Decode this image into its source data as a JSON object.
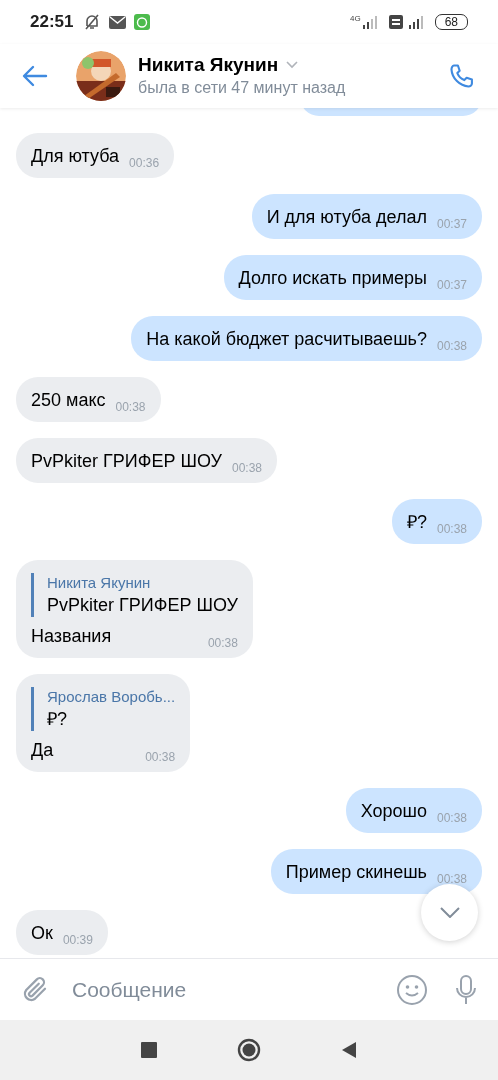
{
  "status_bar": {
    "time": "22:51",
    "network": "4G",
    "battery": "68"
  },
  "header": {
    "name": "Никита Якунин",
    "status": "была в сети 47 минут назад"
  },
  "messages": [
    {
      "kind": "incoming",
      "text": "Для ютуба",
      "time": "00:36"
    },
    {
      "kind": "outgoing",
      "text": "И для ютуба делал",
      "time": "00:37"
    },
    {
      "kind": "outgoing",
      "text": "Долго искать примеры",
      "time": "00:37"
    },
    {
      "kind": "outgoing",
      "text": "На какой бюджет расчитываешь?",
      "time": "00:38"
    },
    {
      "kind": "incoming",
      "text": "250 макс",
      "time": "00:38"
    },
    {
      "kind": "incoming",
      "text": "PvPkiter ГРИФЕР ШОУ",
      "time": "00:38"
    },
    {
      "kind": "outgoing",
      "text": "₽?",
      "time": "00:38"
    },
    {
      "kind": "incoming",
      "text": "Названия",
      "time": "00:38",
      "reply": {
        "author": "Никита Якунин",
        "text": "PvPkiter ГРИФЕР ШОУ"
      }
    },
    {
      "kind": "incoming",
      "text": "Да",
      "time": "00:38",
      "reply": {
        "author": "Ярослав Воробь...",
        "text": "₽?"
      }
    },
    {
      "kind": "outgoing",
      "text": "Хорошо",
      "time": "00:38"
    },
    {
      "kind": "outgoing",
      "text": "Пример скинешь",
      "time": "00:38"
    },
    {
      "kind": "incoming",
      "text": "Ок",
      "time": "00:39"
    }
  ],
  "composer": {
    "placeholder": "Сообщение"
  }
}
